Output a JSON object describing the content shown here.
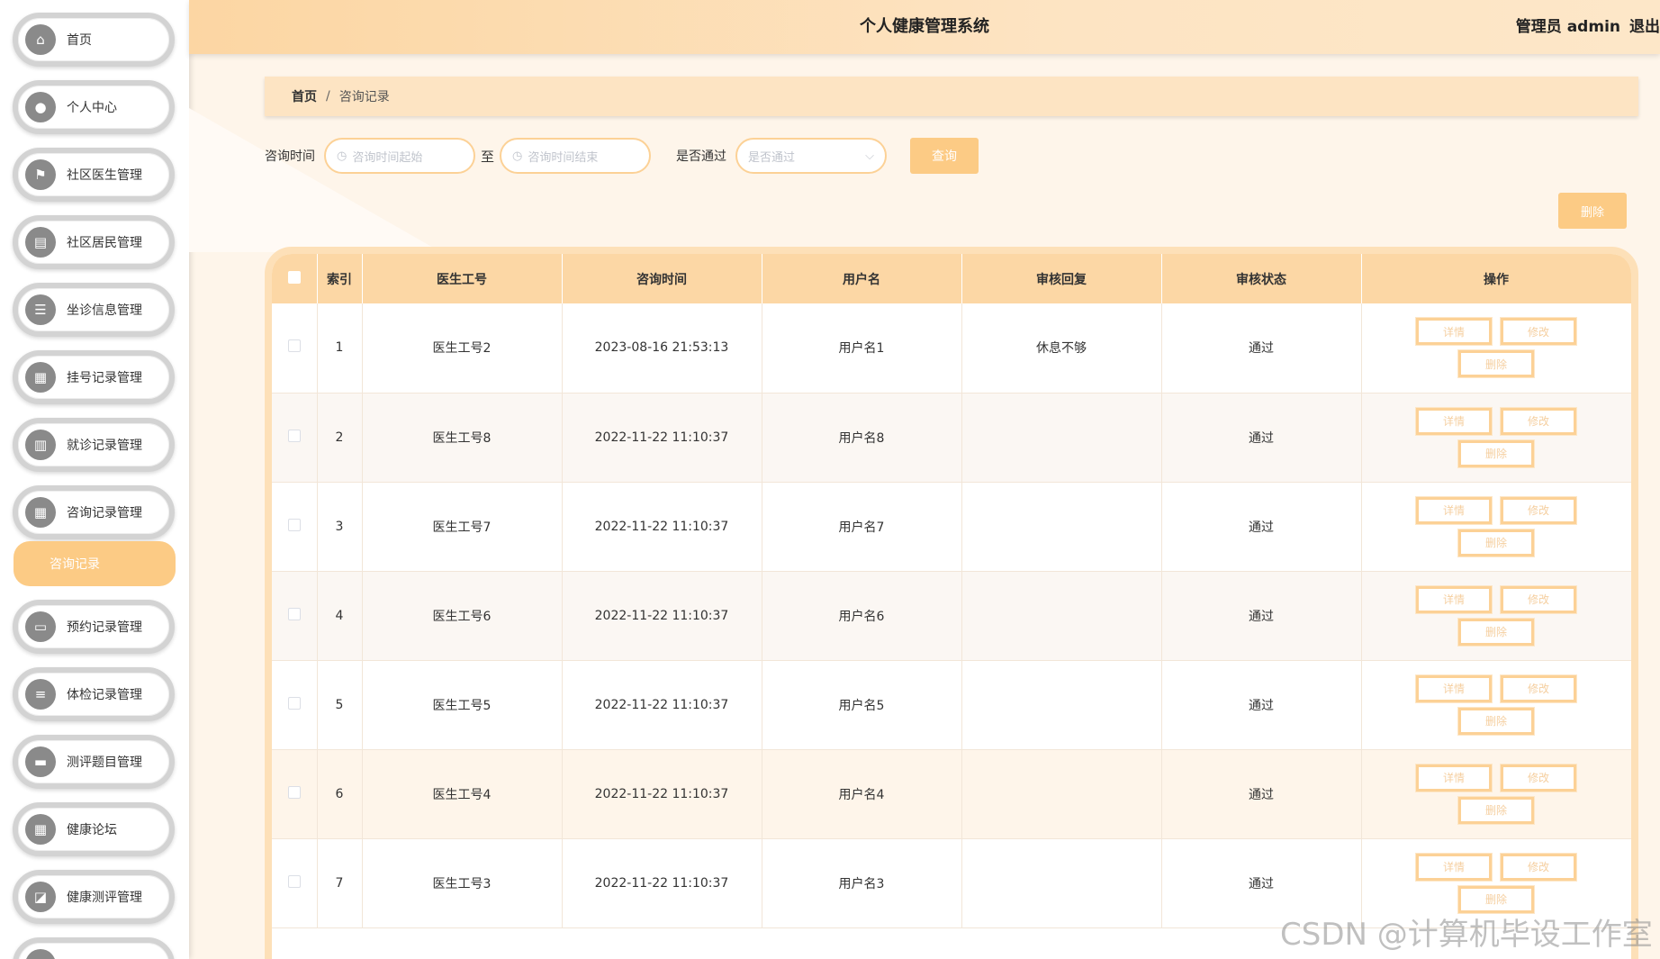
{
  "header": {
    "title": "个人健康管理系统",
    "role": "管理员 admin",
    "logout": "退出"
  },
  "sidebar": {
    "items": [
      {
        "label": "首页",
        "icon": "home-icon"
      },
      {
        "label": "个人中心",
        "icon": "user-icon"
      },
      {
        "label": "社区医生管理",
        "icon": "flag-icon"
      },
      {
        "label": "社区居民管理",
        "icon": "document-icon"
      },
      {
        "label": "坐诊信息管理",
        "icon": "sliders-icon"
      },
      {
        "label": "挂号记录管理",
        "icon": "grid-icon"
      },
      {
        "label": "就诊记录管理",
        "icon": "book-icon"
      },
      {
        "label": "咨询记录管理",
        "icon": "grid-icon"
      },
      {
        "label": "预约记录管理",
        "icon": "monitor-icon"
      },
      {
        "label": "体检记录管理",
        "icon": "list-icon"
      },
      {
        "label": "测评题目管理",
        "icon": "tablet-icon"
      },
      {
        "label": "健康论坛",
        "icon": "grid-icon"
      },
      {
        "label": "健康测评管理",
        "icon": "chart-icon"
      }
    ],
    "active_sub": "咨询记录"
  },
  "breadcrumb": {
    "home": "首页",
    "sep": "/",
    "current": "咨询记录"
  },
  "search": {
    "time_label": "咨询时间",
    "start_placeholder": "咨询时间起始",
    "to": "至",
    "end_placeholder": "咨询时间结束",
    "pass_label": "是否通过",
    "pass_placeholder": "是否通过",
    "query_button": "查询",
    "delete_button": "删除"
  },
  "table": {
    "columns": [
      "索引",
      "医生工号",
      "咨询时间",
      "用户名",
      "审核回复",
      "审核状态",
      "操作"
    ],
    "rows": [
      {
        "index": "1",
        "doctor_id": "医生工号2",
        "time": "2023-08-16 21:53:13",
        "user": "用户名1",
        "reply": "休息不够",
        "status": "通过"
      },
      {
        "index": "2",
        "doctor_id": "医生工号8",
        "time": "2022-11-22 11:10:37",
        "user": "用户名8",
        "reply": "",
        "status": "通过"
      },
      {
        "index": "3",
        "doctor_id": "医生工号7",
        "time": "2022-11-22 11:10:37",
        "user": "用户名7",
        "reply": "",
        "status": "通过"
      },
      {
        "index": "4",
        "doctor_id": "医生工号6",
        "time": "2022-11-22 11:10:37",
        "user": "用户名6",
        "reply": "",
        "status": "通过"
      },
      {
        "index": "5",
        "doctor_id": "医生工号5",
        "time": "2022-11-22 11:10:37",
        "user": "用户名5",
        "reply": "",
        "status": "通过"
      },
      {
        "index": "6",
        "doctor_id": "医生工号4",
        "time": "2022-11-22 11:10:37",
        "user": "用户名4",
        "reply": "",
        "status": "通过"
      },
      {
        "index": "7",
        "doctor_id": "医生工号3",
        "time": "2022-11-22 11:10:37",
        "user": "用户名3",
        "reply": "",
        "status": "通过"
      }
    ],
    "ops": {
      "detail": "详情",
      "edit": "修改",
      "delete": "删除"
    }
  },
  "watermark": "CSDN @计算机毕设工作室",
  "colors": {
    "accent": "#fccb85",
    "header_bg": "#fcd6a3",
    "table_header": "#fcd7a5"
  }
}
